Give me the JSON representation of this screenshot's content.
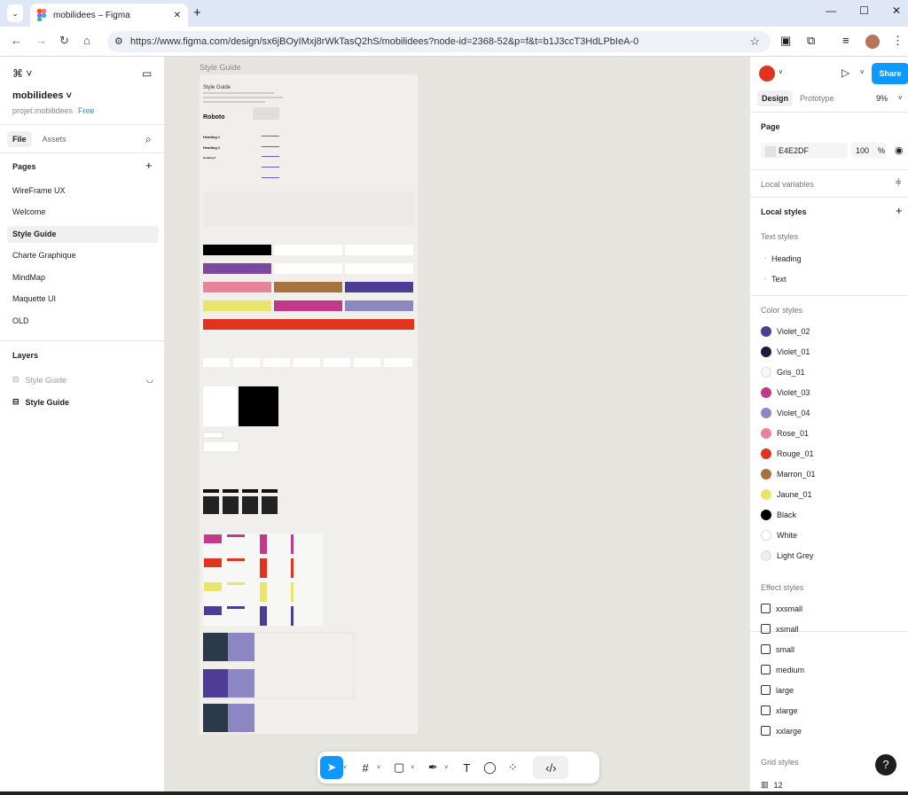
{
  "browser": {
    "tab_title": "mobilidees – Figma",
    "url": "https://www.figma.com/design/sx6jBOyIMxj8rWkTasQ2hS/mobilidees?node-id=2368-52&p=f&t=b1J3ccT3HdLPbIeA-0"
  },
  "left": {
    "project_name": "mobilidees",
    "project_team": "projet.mobilidees",
    "plan": "Free",
    "tab_file": "File",
    "tab_assets": "Assets",
    "pages_title": "Pages",
    "pages": [
      "WireFrame UX",
      "Welcome",
      "Style Guide",
      "Charte Graphique",
      "MindMap",
      "Maquette UI",
      "OLD"
    ],
    "layers_title": "Layers",
    "layers": [
      "Style Guide",
      "Style Guide"
    ]
  },
  "canvas": {
    "frame_label": "Style Guide",
    "frame_text": {
      "title": "Style Guide",
      "font": "Roboto",
      "h1": "Heading 1",
      "h2": "Heading 2",
      "h3": "Heading 3"
    }
  },
  "right": {
    "tab_design": "Design",
    "tab_prototype": "Prototype",
    "zoom": "9%",
    "share": "Share",
    "page_title": "Page",
    "page_color": "E4E2DF",
    "page_opacity": "100",
    "page_opacity_unit": "%",
    "local_variables": "Local variables",
    "local_styles": "Local styles",
    "text_styles": "Text styles",
    "text_items": [
      "Heading",
      "Text"
    ],
    "color_styles": "Color styles",
    "colors": [
      {
        "name": "Violet_02",
        "color": "#4e3d96"
      },
      {
        "name": "Violet_01",
        "color": "#1e1b3d"
      },
      {
        "name": "Gris_01",
        "color": "#f7f7f5"
      },
      {
        "name": "Violet_03",
        "color": "#c2398a"
      },
      {
        "name": "Violet_04",
        "color": "#8c86c2"
      },
      {
        "name": "Rose_01",
        "color": "#e8849a"
      },
      {
        "name": "Rouge_01",
        "color": "#e1341e"
      },
      {
        "name": "Marron_01",
        "color": "#a8723c"
      },
      {
        "name": "Jaune_01",
        "color": "#e8e56a"
      },
      {
        "name": "Black",
        "color": "#000000"
      },
      {
        "name": "White",
        "color": "#ffffff"
      },
      {
        "name": "Light Grey",
        "color": "#eeeeee"
      }
    ],
    "effect_styles": "Effect styles",
    "effects": [
      "xxsmall",
      "xsmall",
      "small",
      "medium",
      "large",
      "xlarge",
      "xxlarge"
    ],
    "grid_styles": "Grid styles",
    "grid_item": "12"
  }
}
